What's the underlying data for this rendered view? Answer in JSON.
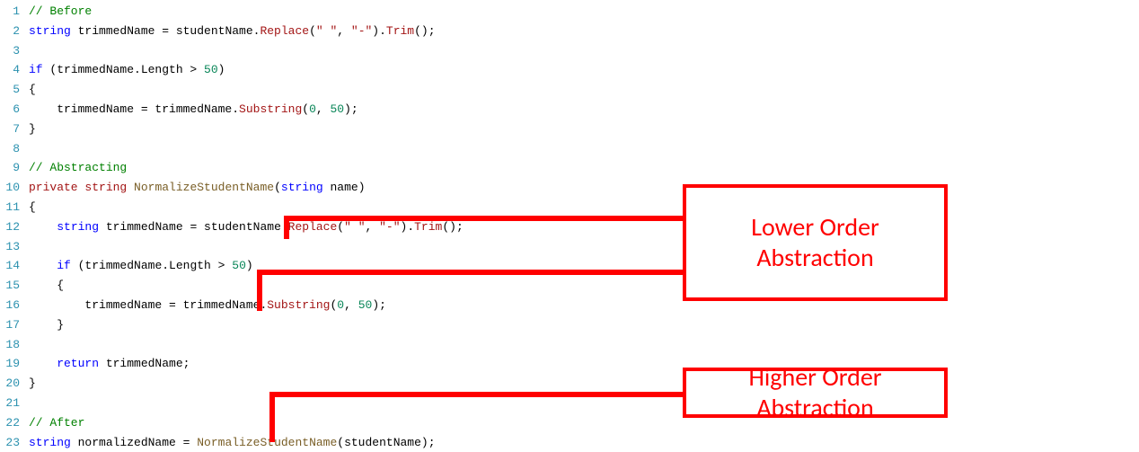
{
  "lineNumbers": [
    "1",
    "2",
    "3",
    "4",
    "5",
    "6",
    "7",
    "8",
    "9",
    "10",
    "11",
    "12",
    "13",
    "14",
    "15",
    "16",
    "17",
    "18",
    "19",
    "20",
    "21",
    "22",
    "23"
  ],
  "code": {
    "l1_comment": "// Before",
    "l2_kw_string": "string",
    "l2_var": " trimmedName = studentName.",
    "l2_replace": "Replace",
    "l2_args_open": "(",
    "l2_str1": "\" \"",
    "l2_comma": ", ",
    "l2_str2": "\"-\"",
    "l2_args_close": ").",
    "l2_trim": "Trim",
    "l2_end": "();",
    "l4_if": "if",
    "l4_cond_open": " (trimmedName.Length > ",
    "l4_num": "50",
    "l4_cond_close": ")",
    "l5_brace": "{",
    "l6_indent": "    trimmedName = trimmedName.",
    "l6_substring": "Substring",
    "l6_open": "(",
    "l6_n1": "0",
    "l6_c": ", ",
    "l6_n2": "50",
    "l6_close": ");",
    "l7_brace": "}",
    "l9_comment": "// Abstracting",
    "l10_private": "private",
    "l10_sp1": " ",
    "l10_string": "string",
    "l10_sp2": " ",
    "l10_name": "NormalizeStudentName",
    "l10_open": "(",
    "l10_pstring": "string",
    "l10_param": " name)",
    "l11_brace": "{",
    "l12_indent": "    ",
    "l12_kw_string": "string",
    "l12_var": " trimmedName = studentName.",
    "l12_replace": "Replace",
    "l12_args_open": "(",
    "l12_str1": "\" \"",
    "l12_comma": ", ",
    "l12_str2": "\"-\"",
    "l12_args_close": ").",
    "l12_trim": "Trim",
    "l12_end": "();",
    "l14_indent": "    ",
    "l14_if": "if",
    "l14_cond_open": " (trimmedName.Length > ",
    "l14_num": "50",
    "l14_cond_close": ")",
    "l15_brace": "    {",
    "l16_indent": "        trimmedName = trimmedName.",
    "l16_substring": "Substring",
    "l16_open": "(",
    "l16_n1": "0",
    "l16_c": ", ",
    "l16_n2": "50",
    "l16_close": ");",
    "l17_brace": "    }",
    "l19_return": "    return",
    "l19_rest": " trimmedName;",
    "l20_brace": "}",
    "l22_comment": "// After",
    "l23_kw_string": "string",
    "l23_var": " normalizedName = ",
    "l23_call": "NormalizeStudentName",
    "l23_args": "(studentName);"
  },
  "annotations": {
    "lower": "Lower Order Abstraction",
    "higher": "Higher Order Abstraction"
  }
}
